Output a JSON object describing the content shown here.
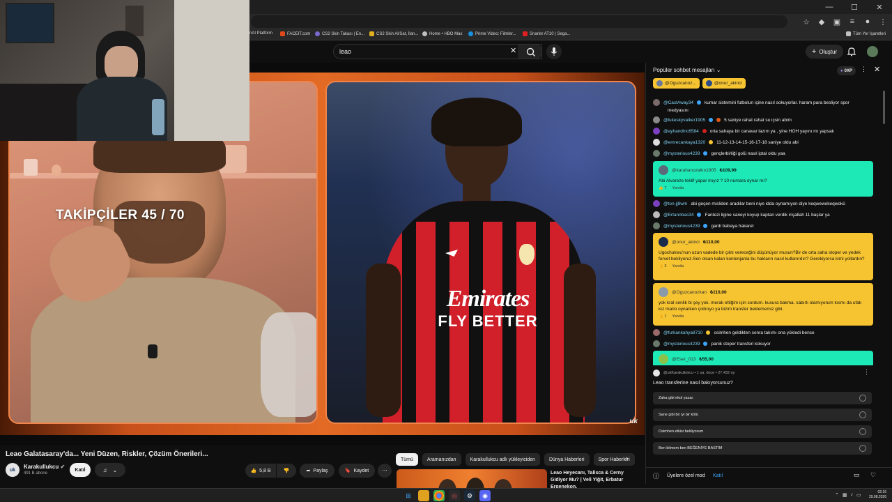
{
  "colors": {
    "bg": "#0f0f0f",
    "superchat_green": "#1de9b6",
    "superchat_yellow": "#f6c431",
    "accent_blue": "#3ea6ff",
    "milan_red": "#d1202a"
  },
  "bookmarks": [
    {
      "label": "nAI Platform",
      "icon": "bookmark-icon"
    },
    {
      "label": "FACEIT.com",
      "icon": "faceit-icon"
    },
    {
      "label": "CS2 Skin Takası | En...",
      "icon": "cs2-icon"
    },
    {
      "label": "CS2 Skin Al/Sat, İlan...",
      "icon": "cs2-icon"
    },
    {
      "label": "Home • HBO Max",
      "icon": "hbo-icon"
    },
    {
      "label": "Prime Video: Filmler...",
      "icon": "prime-icon"
    },
    {
      "label": "Snarler AT10 | Sega...",
      "icon": "snarler-icon"
    },
    {
      "label": "Tüm Yer İşaretleri",
      "icon": "folder-icon"
    }
  ],
  "youtube": {
    "search_value": "leao",
    "create_label": "Oluştur"
  },
  "video": {
    "overlay_text": "TAKİPÇİLER 45 / 70",
    "jersey_sponsor": "Emirates",
    "jersey_slogan": "FLY BETTER",
    "watermark": "uk",
    "title": "Leao Galatasaray'da... Yeni Düzen, Riskler, Çözüm Önerileri...",
    "channel_name": "Karakullukcu",
    "channel_avatar_text": "uk",
    "subscribers": "491 B abone",
    "join_label": "Katıl",
    "likes": "5,8 B",
    "share_label": "Paylaş",
    "save_label": "Kaydet"
  },
  "chips": [
    "Tümü",
    "Aramanızdan",
    "Karakullukcu adlı yükleyiciden",
    "Dünya Haberleri",
    "Spor Haberleri"
  ],
  "recommendation": {
    "title": "Leao Heyecanı, Talisca & Cerny Gidiyor Mu? | Veli Yiğit, Erbatur Ergenekon,"
  },
  "chat": {
    "title": "Popüler sohbet mesajları",
    "xp": "0XP",
    "pinned": [
      "@Oguzcanoz...",
      "@onur_akinci"
    ],
    "messages_top": [
      {
        "user": "@CastAway34",
        "text": "kumar sistemini futbolun içine nasıl sokuyorlar. haram para besliyor spor"
      },
      {
        "user": "medyasını",
        "text": ""
      },
      {
        "user": "@lukeskyvalker1905",
        "text": "5 saniye rahat rahat su içsin abim"
      },
      {
        "user": "@ayhandinc6584",
        "text": "orta sahaya bir canavar lazım ya , yine HOH yayını mı yapsak"
      },
      {
        "user": "@emrecankaya1320",
        "text": "11-12-13-14-15-16-17-18 saniye oldu abi"
      },
      {
        "user": "@mysterious4239",
        "text": "gençlerbirliği golü nasıl iptal oldu yaa"
      }
    ],
    "superchat1": {
      "user": "@karahanozaltın1905",
      "amount": "₺109,99",
      "text": "Abi Alvareze teklif yapar mıyız ? 10 numara oynar mı?",
      "likes": "7",
      "reply": "Yanıtla"
    },
    "messages_mid": [
      {
        "user": "@ton-jj8wm",
        "text": "abi geçen misliden aradılar beni niye idda oynamıyon diye keqwewokeqwokü"
      },
      {
        "user": "@Ertannbas34",
        "text": "Fantezi ligine saneyi koyup kaptan verdik inşallah 11 başlar ya"
      },
      {
        "user": "@mysterious4239",
        "text": "gardi babaya hakaret"
      }
    ],
    "superchat2": {
      "user": "@onur_akinci",
      "amount": "₺110,00",
      "text": "Ugochukwu'nun uzun vadede bir çıktı vereceğini düşünüyor musun?Bir de orta saha stoper ve yedek forvet bekliyoruz.Sen olsan kalan kontenjanla bu hakların nasıl kullanırdın? Gerekiyorsa kimi yollardın?",
      "likes": "3",
      "reply": "Yanıtla"
    },
    "superchat3": {
      "user": "@Oguzcanozkan",
      "amount": "₺110,00",
      "text": "yok kral senlik bi şey yok. merak ettiğim için sordum. kusura bakma. sabırlı olamıyorum kısmı da ufak kız mario oynarken çıldırıyo ya bizim transfer beklememiz gibi.",
      "likes": "1",
      "reply": "Yanıtla"
    },
    "messages_bottom": [
      {
        "user": "@furkankahya8710",
        "text": "osimhen geldikten sonra takımı ona yükledi bence"
      },
      {
        "user": "@mysterious4239",
        "text": "panik stoper transferi kokuyor"
      }
    ],
    "superchat4": {
      "user": "@Eser_013",
      "amount": "₺55,00"
    },
    "poll": {
      "header": "@ukKarakullukcu • 1 sa. önce • 27.432 oy",
      "question": "Leao transferine nasıl bakıyorsunuz?",
      "options": [
        "Zaha gibi ekol yazar.",
        "Sane gibi bir iyi bir kötü",
        "Osimhen etkisi bekliyorum",
        "Ben bilmem ben BEĞENİYE BASTIM"
      ]
    },
    "footer_text": "Üyelere özel mod",
    "footer_join": "Katıl"
  },
  "taskbar": {
    "time": "02:16",
    "date": "29.08.2026"
  }
}
